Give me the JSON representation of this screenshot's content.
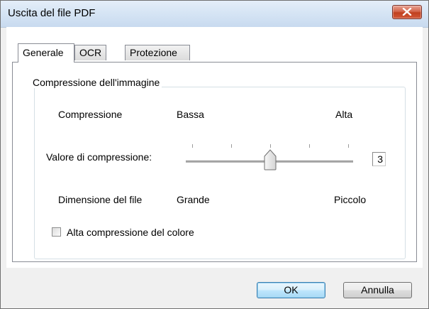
{
  "window": {
    "title": "Uscita del file PDF",
    "close_icon": "close-icon"
  },
  "tabs": [
    {
      "label": "Generale",
      "active": true
    },
    {
      "label": "OCR",
      "active": false
    },
    {
      "label": "Protezione",
      "active": false
    }
  ],
  "compression_group": {
    "title": "Compressione dell'immagine",
    "compression_label": "Compressione",
    "low_label": "Bassa",
    "high_label": "Alta",
    "value_label": "Valore di compressione:",
    "slider": {
      "min": 1,
      "max": 5,
      "value": 3,
      "tick_count": 5
    },
    "value_text": "3",
    "file_size_label": "Dimensione del file",
    "large_label": "Grande",
    "small_label": "Piccolo"
  },
  "color_compression": {
    "label": "Alta compressione del colore",
    "checked": false
  },
  "buttons": {
    "ok": "OK",
    "cancel": "Annulla"
  },
  "colors": {
    "close_button": "#c9452a",
    "default_button_border": "#3c7fb1"
  }
}
